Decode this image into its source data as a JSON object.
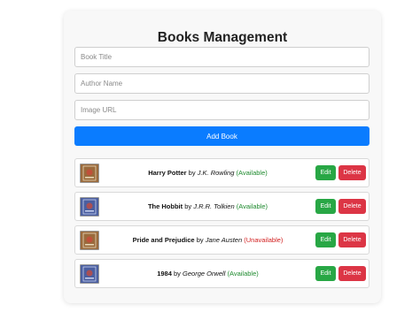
{
  "app": {
    "title": "Books Management"
  },
  "form": {
    "title_placeholder": "Book Title",
    "author_placeholder": "Author Name",
    "image_placeholder": "Image URL",
    "title_value": "",
    "author_value": "",
    "image_value": "",
    "add_label": "Add Book"
  },
  "books": [
    {
      "title": "Harry Potter",
      "by": "by",
      "author": "J.K. Rowling",
      "status": "(Available)",
      "status_type": "available",
      "cover_color": "#9a6a3c",
      "edit_label": "Edit",
      "delete_label": "Delete"
    },
    {
      "title": "The Hobbit",
      "by": "by",
      "author": "J.R.R. Tolkien",
      "status": "(Available)",
      "status_type": "available",
      "cover_color": "#4b5fa0",
      "edit_label": "Edit",
      "delete_label": "Delete"
    },
    {
      "title": "Pride and Prejudice",
      "by": "by",
      "author": "Jane Austen",
      "status": "(Unavailable)",
      "status_type": "unavailable",
      "cover_color": "#9a6a3c",
      "edit_label": "Edit",
      "delete_label": "Delete"
    },
    {
      "title": "1984",
      "by": "by",
      "author": "George Orwell",
      "status": "(Available)",
      "status_type": "available",
      "cover_color": "#4b5fa0",
      "edit_label": "Edit",
      "delete_label": "Delete"
    }
  ],
  "colors": {
    "primary": "#0a7cff",
    "edit": "#28a745",
    "delete": "#dc3545",
    "available": "#1e8a2e",
    "unavailable": "#d21f1f"
  },
  "icons": {
    "cover": "book-cover-icon"
  }
}
